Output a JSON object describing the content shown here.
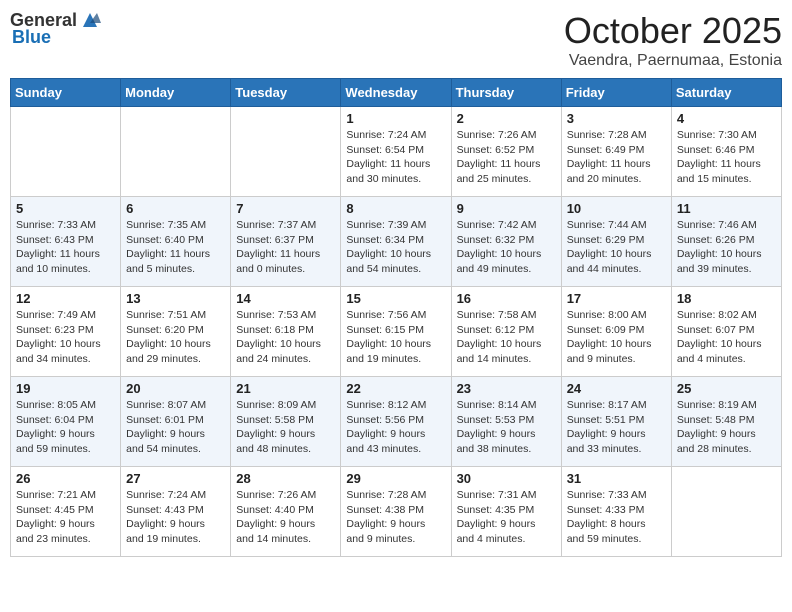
{
  "header": {
    "logo_general": "General",
    "logo_blue": "Blue",
    "month": "October 2025",
    "location": "Vaendra, Paernumaa, Estonia"
  },
  "weekdays": [
    "Sunday",
    "Monday",
    "Tuesday",
    "Wednesday",
    "Thursday",
    "Friday",
    "Saturday"
  ],
  "weeks": [
    [
      {
        "day": "",
        "info": ""
      },
      {
        "day": "",
        "info": ""
      },
      {
        "day": "",
        "info": ""
      },
      {
        "day": "1",
        "info": "Sunrise: 7:24 AM\nSunset: 6:54 PM\nDaylight: 11 hours\nand 30 minutes."
      },
      {
        "day": "2",
        "info": "Sunrise: 7:26 AM\nSunset: 6:52 PM\nDaylight: 11 hours\nand 25 minutes."
      },
      {
        "day": "3",
        "info": "Sunrise: 7:28 AM\nSunset: 6:49 PM\nDaylight: 11 hours\nand 20 minutes."
      },
      {
        "day": "4",
        "info": "Sunrise: 7:30 AM\nSunset: 6:46 PM\nDaylight: 11 hours\nand 15 minutes."
      }
    ],
    [
      {
        "day": "5",
        "info": "Sunrise: 7:33 AM\nSunset: 6:43 PM\nDaylight: 11 hours\nand 10 minutes."
      },
      {
        "day": "6",
        "info": "Sunrise: 7:35 AM\nSunset: 6:40 PM\nDaylight: 11 hours\nand 5 minutes."
      },
      {
        "day": "7",
        "info": "Sunrise: 7:37 AM\nSunset: 6:37 PM\nDaylight: 11 hours\nand 0 minutes."
      },
      {
        "day": "8",
        "info": "Sunrise: 7:39 AM\nSunset: 6:34 PM\nDaylight: 10 hours\nand 54 minutes."
      },
      {
        "day": "9",
        "info": "Sunrise: 7:42 AM\nSunset: 6:32 PM\nDaylight: 10 hours\nand 49 minutes."
      },
      {
        "day": "10",
        "info": "Sunrise: 7:44 AM\nSunset: 6:29 PM\nDaylight: 10 hours\nand 44 minutes."
      },
      {
        "day": "11",
        "info": "Sunrise: 7:46 AM\nSunset: 6:26 PM\nDaylight: 10 hours\nand 39 minutes."
      }
    ],
    [
      {
        "day": "12",
        "info": "Sunrise: 7:49 AM\nSunset: 6:23 PM\nDaylight: 10 hours\nand 34 minutes."
      },
      {
        "day": "13",
        "info": "Sunrise: 7:51 AM\nSunset: 6:20 PM\nDaylight: 10 hours\nand 29 minutes."
      },
      {
        "day": "14",
        "info": "Sunrise: 7:53 AM\nSunset: 6:18 PM\nDaylight: 10 hours\nand 24 minutes."
      },
      {
        "day": "15",
        "info": "Sunrise: 7:56 AM\nSunset: 6:15 PM\nDaylight: 10 hours\nand 19 minutes."
      },
      {
        "day": "16",
        "info": "Sunrise: 7:58 AM\nSunset: 6:12 PM\nDaylight: 10 hours\nand 14 minutes."
      },
      {
        "day": "17",
        "info": "Sunrise: 8:00 AM\nSunset: 6:09 PM\nDaylight: 10 hours\nand 9 minutes."
      },
      {
        "day": "18",
        "info": "Sunrise: 8:02 AM\nSunset: 6:07 PM\nDaylight: 10 hours\nand 4 minutes."
      }
    ],
    [
      {
        "day": "19",
        "info": "Sunrise: 8:05 AM\nSunset: 6:04 PM\nDaylight: 9 hours\nand 59 minutes."
      },
      {
        "day": "20",
        "info": "Sunrise: 8:07 AM\nSunset: 6:01 PM\nDaylight: 9 hours\nand 54 minutes."
      },
      {
        "day": "21",
        "info": "Sunrise: 8:09 AM\nSunset: 5:58 PM\nDaylight: 9 hours\nand 48 minutes."
      },
      {
        "day": "22",
        "info": "Sunrise: 8:12 AM\nSunset: 5:56 PM\nDaylight: 9 hours\nand 43 minutes."
      },
      {
        "day": "23",
        "info": "Sunrise: 8:14 AM\nSunset: 5:53 PM\nDaylight: 9 hours\nand 38 minutes."
      },
      {
        "day": "24",
        "info": "Sunrise: 8:17 AM\nSunset: 5:51 PM\nDaylight: 9 hours\nand 33 minutes."
      },
      {
        "day": "25",
        "info": "Sunrise: 8:19 AM\nSunset: 5:48 PM\nDaylight: 9 hours\nand 28 minutes."
      }
    ],
    [
      {
        "day": "26",
        "info": "Sunrise: 7:21 AM\nSunset: 4:45 PM\nDaylight: 9 hours\nand 23 minutes."
      },
      {
        "day": "27",
        "info": "Sunrise: 7:24 AM\nSunset: 4:43 PM\nDaylight: 9 hours\nand 19 minutes."
      },
      {
        "day": "28",
        "info": "Sunrise: 7:26 AM\nSunset: 4:40 PM\nDaylight: 9 hours\nand 14 minutes."
      },
      {
        "day": "29",
        "info": "Sunrise: 7:28 AM\nSunset: 4:38 PM\nDaylight: 9 hours\nand 9 minutes."
      },
      {
        "day": "30",
        "info": "Sunrise: 7:31 AM\nSunset: 4:35 PM\nDaylight: 9 hours\nand 4 minutes."
      },
      {
        "day": "31",
        "info": "Sunrise: 7:33 AM\nSunset: 4:33 PM\nDaylight: 8 hours\nand 59 minutes."
      },
      {
        "day": "",
        "info": ""
      }
    ]
  ]
}
